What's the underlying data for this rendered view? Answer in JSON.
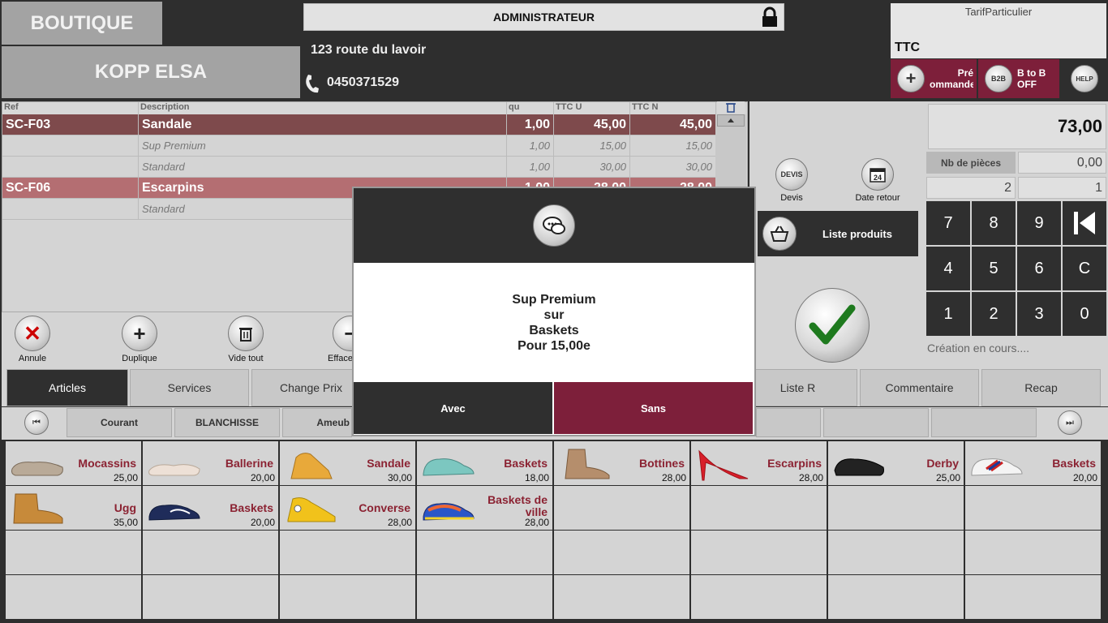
{
  "header": {
    "shop": "BOUTIQUE",
    "client_name": "KOPP ELSA",
    "user": "ADMINISTRATEUR",
    "address": "123 route du lavoir",
    "phone": "0450371529",
    "tarif": "TarifParticulier",
    "price_mode": "TTC",
    "precommande_label_1": "Pré",
    "precommande_label_2": "ommande",
    "b2b_icon": "B2B",
    "b2b_label_1": "B to B",
    "b2b_label_2": "OFF",
    "help_icon": "HELP"
  },
  "ticket": {
    "columns": [
      "Ref",
      "Description",
      "qu",
      "TTC U",
      "TTC N"
    ],
    "rows": [
      {
        "ref": "SC-F03",
        "desc": "Sandale",
        "qty": "1,00",
        "unit": "45,00",
        "net": "45,00"
      },
      {
        "ref": "",
        "desc": "Sup Premium",
        "qty": "1,00",
        "unit": "15,00",
        "net": "15,00"
      },
      {
        "ref": "",
        "desc": "Standard",
        "qty": "1,00",
        "unit": "30,00",
        "net": "30,00"
      },
      {
        "ref": "SC-F06",
        "desc": "Escarpins",
        "qty": "1,00",
        "unit": "28,00",
        "net": "28,00"
      },
      {
        "ref": "",
        "desc": "Standard",
        "qty": "",
        "unit": "",
        "net": ""
      }
    ]
  },
  "actions": {
    "annule": "Annule",
    "duplique": "Duplique",
    "vide_tout": "Vide tout",
    "efface": "Efface"
  },
  "right": {
    "total": "73,00",
    "nb_pieces_label": "Nb de pièces",
    "nb_pieces_value": "0,00",
    "qty_left": "2",
    "qty_right": "1",
    "devis_icon": "DEVIS",
    "devis": "Devis",
    "date_icon": "24",
    "date_retour": "Date retour",
    "liste_produits": "Liste produits",
    "status": "Création en cours....",
    "keys": [
      "7",
      "8",
      "9",
      "4",
      "5",
      "6",
      "C",
      "1",
      "2",
      "3",
      "0"
    ]
  },
  "tabs": [
    "Articles",
    "Services",
    "Change Prix",
    "Liste R",
    "Commentaire",
    "Recap"
  ],
  "categories": [
    "Courant",
    "BLANCHISSE",
    "Ameub"
  ],
  "products": [
    {
      "name": "Mocassins",
      "price": "25,00"
    },
    {
      "name": "Ballerine",
      "price": "20,00"
    },
    {
      "name": "Sandale",
      "price": "30,00"
    },
    {
      "name": "Baskets",
      "price": "18,00"
    },
    {
      "name": "Bottines",
      "price": "28,00"
    },
    {
      "name": "Escarpins",
      "price": "28,00"
    },
    {
      "name": "Derby",
      "price": "25,00"
    },
    {
      "name": "Baskets",
      "price": "20,00"
    },
    {
      "name": "Ugg",
      "price": "35,00"
    },
    {
      "name": "Baskets",
      "price": "20,00"
    },
    {
      "name": "Converse",
      "price": "28,00"
    },
    {
      "name": "Baskets de",
      "name2": "ville",
      "price": "28,00"
    }
  ],
  "modal": {
    "line1": "Sup Premium",
    "line2": "sur",
    "line3": "Baskets",
    "line4": "Pour 15,00e",
    "avec": "Avec",
    "sans": "Sans"
  },
  "colors": {
    "accent": "#7d1f3a",
    "dark": "#2f2f2f",
    "row_selected": "#7e4a4c",
    "row_second": "#b46e72"
  }
}
